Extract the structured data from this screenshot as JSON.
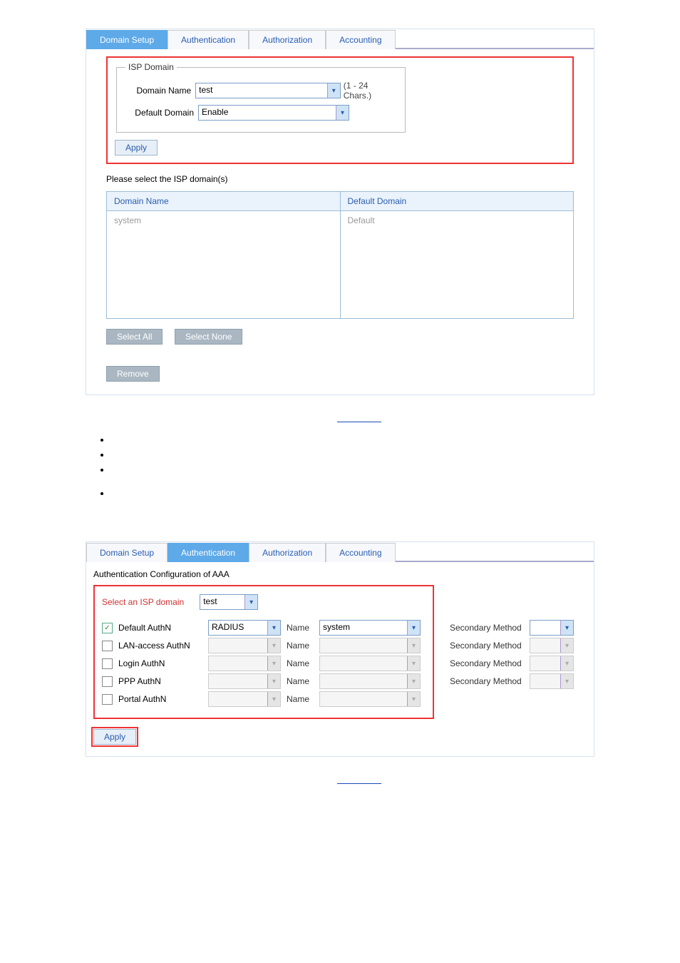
{
  "fig1": {
    "tabs": [
      "Domain Setup",
      "Authentication",
      "Authorization",
      "Accounting"
    ],
    "active_tab": 0,
    "fieldset_legend": "ISP Domain",
    "domain_name_label": "Domain Name",
    "domain_name_value": "test",
    "domain_name_hint": "(1 - 24 Chars.)",
    "default_domain_label": "Default Domain",
    "default_domain_value": "Enable",
    "apply_label": "Apply",
    "prompt": "Please select the ISP domain(s)",
    "table_head_name": "Domain Name",
    "table_head_default": "Default Domain",
    "row_name": "system",
    "row_default": "Default",
    "select_all": "Select All",
    "select_none": "Select None",
    "remove": "Remove"
  },
  "fig2": {
    "tabs": [
      "Domain Setup",
      "Authentication",
      "Authorization",
      "Accounting"
    ],
    "active_tab": 1,
    "title": "Authentication Configuration of AAA",
    "select_label": "Select an ISP domain",
    "select_value": "test",
    "rows": [
      {
        "checked": true,
        "label": "Default AuthN",
        "method": "RADIUS",
        "name": "system",
        "secondary": true,
        "enabled": true
      },
      {
        "checked": false,
        "label": "LAN-access AuthN",
        "method": "",
        "name": "",
        "secondary": true,
        "enabled": false
      },
      {
        "checked": false,
        "label": "Login AuthN",
        "method": "",
        "name": "",
        "secondary": true,
        "enabled": false
      },
      {
        "checked": false,
        "label": "PPP AuthN",
        "method": "",
        "name": "",
        "secondary": true,
        "enabled": false
      },
      {
        "checked": false,
        "label": "Portal AuthN",
        "method": "",
        "name": "",
        "secondary": false,
        "enabled": false
      }
    ],
    "name_lbl": "Name",
    "secondary_lbl": "Secondary Method",
    "apply_label": "Apply"
  }
}
